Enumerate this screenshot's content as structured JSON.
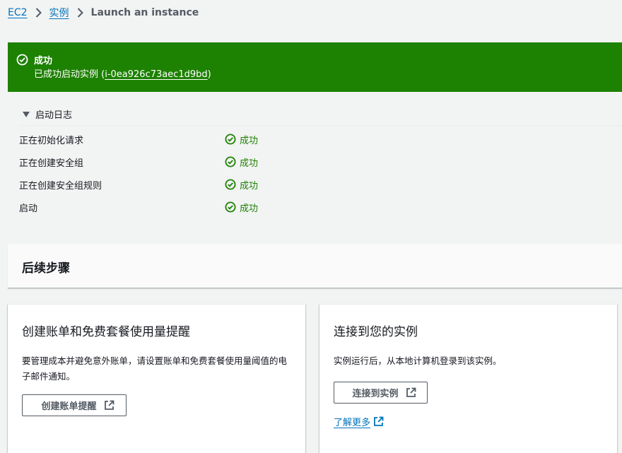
{
  "breadcrumb": {
    "items": [
      "EC2",
      "实例"
    ],
    "current": "Launch an instance"
  },
  "flash": {
    "title": "成功",
    "message_prefix": "已成功启动实例 (",
    "instance_id": "i-0ea926c73aec1d9bd",
    "message_suffix": ")"
  },
  "launch_log": {
    "title": "启动日志",
    "rows": [
      {
        "step": "正在初始化请求",
        "status": "成功"
      },
      {
        "step": "正在创建安全组",
        "status": "成功"
      },
      {
        "step": "正在创建安全组规则",
        "status": "成功"
      },
      {
        "step": "启动",
        "status": "成功"
      }
    ]
  },
  "next_steps": {
    "title": "后续步骤",
    "cards": [
      {
        "title": "创建账单和免费套餐使用量提醒",
        "description": "要管理成本并避免意外账单，请设置账单和免费套餐使用量阈值的电子邮件通知。",
        "button": "创建账单提醒"
      },
      {
        "title": "连接到您的实例",
        "description": "实例运行后，从本地计算机登录到该实例。",
        "button": "连接到实例",
        "link": "了解更多"
      }
    ]
  },
  "colors": {
    "success": "#1d8102",
    "link": "#0073bb",
    "text": "#16191f",
    "secondary": "#545b64",
    "background": "#f2f3f3"
  }
}
